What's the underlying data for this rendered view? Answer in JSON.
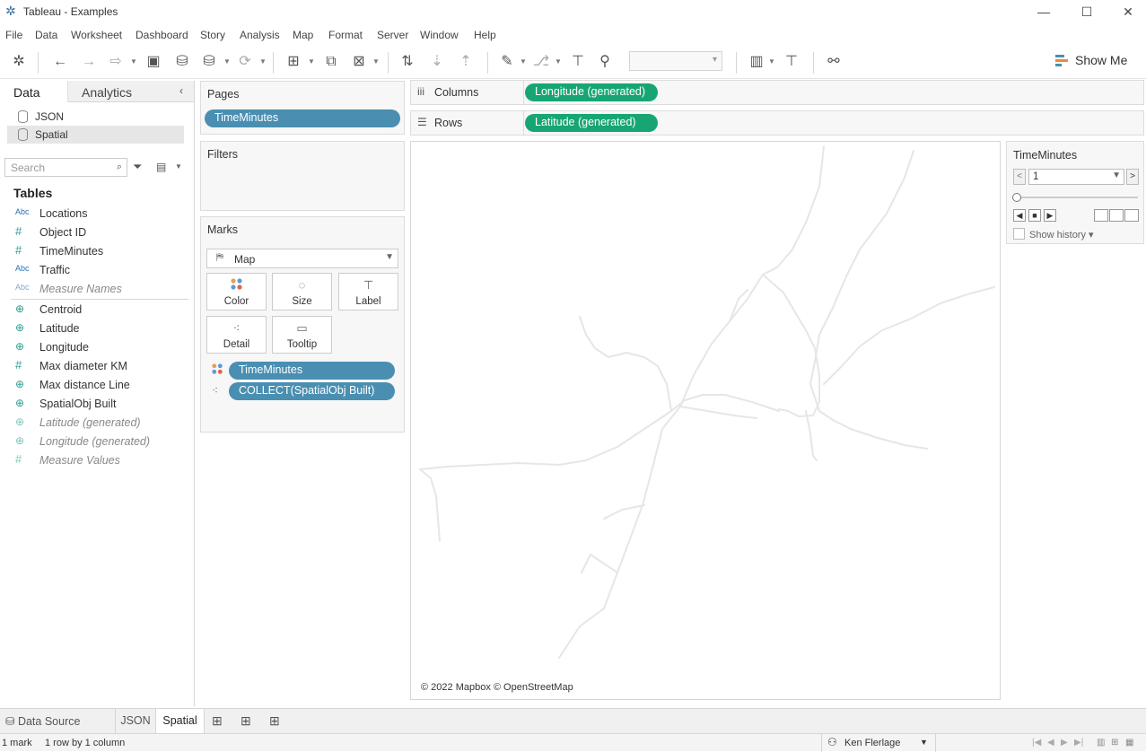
{
  "window": {
    "title": "Tableau - Examples",
    "minimize_glyph": "—",
    "maximize_glyph": "☐",
    "close_glyph": "✕"
  },
  "menu": [
    "File",
    "Data",
    "Worksheet",
    "Dashboard",
    "Story",
    "Analysis",
    "Map",
    "Format",
    "Server",
    "Window",
    "Help"
  ],
  "toolbar": {
    "show_me_label": "Show Me",
    "icons": [
      "tableau-logo-icon",
      "undo-icon",
      "redo-icon",
      "replay-icon",
      "save-icon",
      "new-datasource-icon",
      "pause-updates-icon",
      "refresh-icon",
      "new-worksheet-icon",
      "duplicate-icon",
      "clear-sheet-icon",
      "swap-icon",
      "sort-ascending-icon",
      "sort-descending-icon",
      "highlight-icon",
      "group-icon",
      "label-icon",
      "pin-icon",
      "fit-icon",
      "presentation-icon",
      "share-icon"
    ]
  },
  "data_pane": {
    "tab_data": "Data",
    "tab_analytics": "Analytics",
    "collapse_glyph": "‹",
    "datasources": [
      {
        "name": "JSON",
        "selected": false
      },
      {
        "name": "Spatial",
        "selected": true
      }
    ],
    "search_placeholder": "Search",
    "tables_header": "Tables",
    "dimensions": [
      {
        "name": "Locations",
        "type": "Abc",
        "generated": false
      },
      {
        "name": "Object ID",
        "type": "#",
        "generated": false
      },
      {
        "name": "TimeMinutes",
        "type": "#",
        "generated": false
      },
      {
        "name": "Traffic",
        "type": "Abc",
        "generated": false
      },
      {
        "name": "Measure Names",
        "type": "Abc",
        "generated": true
      }
    ],
    "measures": [
      {
        "name": "Centroid",
        "type": "geo",
        "generated": false
      },
      {
        "name": "Latitude",
        "type": "geo",
        "generated": false
      },
      {
        "name": "Longitude",
        "type": "geo",
        "generated": false
      },
      {
        "name": "Max diameter KM",
        "type": "#",
        "generated": false
      },
      {
        "name": "Max distance Line",
        "type": "geo",
        "generated": false
      },
      {
        "name": "SpatialObj Built",
        "type": "geo",
        "generated": false
      },
      {
        "name": "Latitude (generated)",
        "type": "geo",
        "generated": true
      },
      {
        "name": "Longitude (generated)",
        "type": "geo",
        "generated": true
      },
      {
        "name": "Measure Values",
        "type": "#",
        "generated": true
      }
    ]
  },
  "pages": {
    "header": "Pages",
    "pill": "TimeMinutes"
  },
  "filters": {
    "header": "Filters"
  },
  "marks": {
    "header": "Marks",
    "type": "Map",
    "buttons": [
      "Color",
      "Size",
      "Label",
      "Detail",
      "Tooltip"
    ],
    "pills": [
      "TimeMinutes",
      "COLLECT(SpatialObj Built)"
    ]
  },
  "shelves": {
    "columns_label": "Columns",
    "columns_pill": "Longitude (generated)",
    "rows_label": "Rows",
    "rows_pill": "Latitude (generated)"
  },
  "view": {
    "attribution": "© 2022 Mapbox © OpenStreetMap"
  },
  "page_control": {
    "title": "TimeMinutes",
    "value": "1",
    "show_history": "Show history"
  },
  "sheet_tabs": {
    "data_source": "Data Source",
    "sheets": [
      {
        "name": "JSON",
        "active": false
      },
      {
        "name": "Spatial",
        "active": true
      }
    ]
  },
  "status": {
    "marks": "1 mark",
    "dims": "1 row by 1 column",
    "user": "Ken Flerlage"
  },
  "colors": {
    "pill_dimension": "#4a8fb1",
    "pill_continuous": "#17a673",
    "road": "#e8e8e8"
  }
}
